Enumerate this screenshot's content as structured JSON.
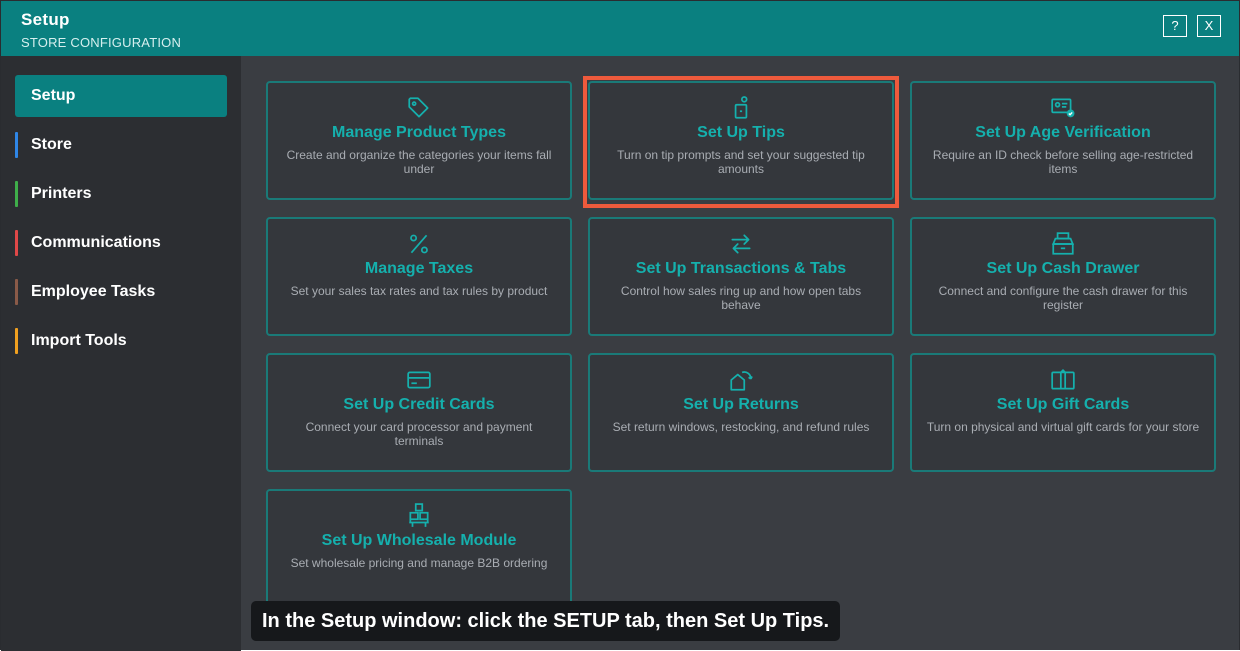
{
  "window": {
    "title": "Setup",
    "subtitle": "STORE CONFIGURATION",
    "help_label": "?",
    "close_label": "X"
  },
  "sidebar": {
    "items": [
      {
        "label": "Setup",
        "active": true
      },
      {
        "label": "Store",
        "color": "#2f86e6"
      },
      {
        "label": "Printers",
        "color": "#3fae4a"
      },
      {
        "label": "Communications",
        "color": "#e04848"
      },
      {
        "label": "Employee Tasks",
        "color": "#8a5a48"
      },
      {
        "label": "Import Tools",
        "color": "#f0a020"
      }
    ]
  },
  "tiles": [
    {
      "title": "Manage Product Types",
      "desc": "Create and organize the categories your items fall under",
      "icon": "tag-icon"
    },
    {
      "title": "Set Up Tips",
      "desc": "Turn on tip prompts and set your suggested tip amounts",
      "icon": "tip-jar-icon"
    },
    {
      "title": "Set Up Age Verification",
      "desc": "Require an ID check before selling age-restricted items",
      "icon": "id-card-check-icon"
    },
    {
      "title": "Manage Taxes",
      "desc": "Set your sales tax rates and tax rules by product",
      "icon": "percent-icon"
    },
    {
      "title": "Set Up Transactions & Tabs",
      "desc": "Control how sales ring up and how open tabs behave",
      "icon": "swap-arrows-icon"
    },
    {
      "title": "Set Up Cash Drawer",
      "desc": "Connect and configure the cash drawer for this register",
      "icon": "cash-drawer-icon"
    },
    {
      "title": "Set Up Credit Cards",
      "desc": "Connect your card processor and payment terminals",
      "icon": "credit-card-icon"
    },
    {
      "title": "Set Up Returns",
      "desc": "Set return windows, restocking, and refund rules",
      "icon": "return-icon"
    },
    {
      "title": "Set Up Gift Cards",
      "desc": "Turn on physical and virtual gift cards for your store",
      "icon": "gift-card-icon"
    },
    {
      "title": "Set Up Wholesale Module",
      "desc": "Set wholesale pricing and manage B2B ordering",
      "icon": "wholesale-icon"
    }
  ],
  "caption": "In the Setup window: click the SETUP tab, then Set Up Tips.",
  "colors": {
    "accent": "#0a8080",
    "tile_title": "#15b0ad",
    "highlight": "#ee5a3c"
  }
}
